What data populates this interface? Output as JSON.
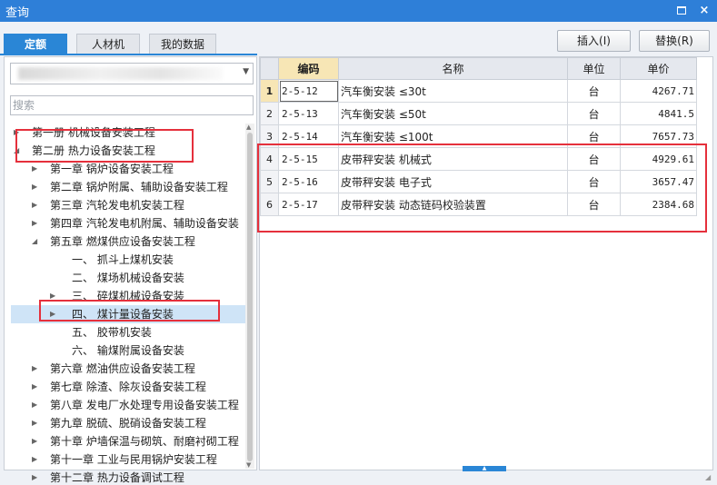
{
  "window": {
    "title": "查询",
    "maximize_icon": "maximize-icon",
    "close_symbol": "×"
  },
  "tabs": [
    {
      "label": "定额",
      "active": true
    },
    {
      "label": "人材机",
      "active": false
    },
    {
      "label": "我的数据",
      "active": false
    }
  ],
  "actions": {
    "insert_label": "插入(I)",
    "replace_label": "替换(R)"
  },
  "left": {
    "library_select": {
      "value": ""
    },
    "search": {
      "placeholder": "搜索"
    },
    "tree": [
      {
        "label": "第一册  机械设备安装工程",
        "level": 0,
        "state": "collapsed"
      },
      {
        "label": "第二册  热力设备安装工程",
        "level": 0,
        "state": "expanded"
      },
      {
        "label": "第一章  锅炉设备安装工程",
        "level": 1,
        "state": "collapsed"
      },
      {
        "label": "第二章  锅炉附属、辅助设备安装工程",
        "level": 1,
        "state": "collapsed"
      },
      {
        "label": "第三章  汽轮发电机安装工程",
        "level": 1,
        "state": "collapsed"
      },
      {
        "label": "第四章  汽轮发电机附属、辅助设备安装",
        "level": 1,
        "state": "collapsed"
      },
      {
        "label": "第五章  燃煤供应设备安装工程",
        "level": 1,
        "state": "expanded"
      },
      {
        "label": "一、  抓斗上煤机安装",
        "level": 2,
        "state": "leaf"
      },
      {
        "label": "二、  煤场机械设备安装",
        "level": 2,
        "state": "leaf"
      },
      {
        "label": "三、  碎煤机械设备安装",
        "level": 2,
        "state": "collapsed"
      },
      {
        "label": "四、  煤计量设备安装",
        "level": 2,
        "state": "collapsed",
        "selected": true
      },
      {
        "label": "五、  胶带机安装",
        "level": 2,
        "state": "leaf"
      },
      {
        "label": "六、  输煤附属设备安装",
        "level": 2,
        "state": "leaf"
      },
      {
        "label": "第六章  燃油供应设备安装工程",
        "level": 1,
        "state": "collapsed"
      },
      {
        "label": "第七章  除渣、除灰设备安装工程",
        "level": 1,
        "state": "collapsed"
      },
      {
        "label": "第八章  发电厂水处理专用设备安装工程",
        "level": 1,
        "state": "collapsed"
      },
      {
        "label": "第九章  脱硫、脱硝设备安装工程",
        "level": 1,
        "state": "collapsed"
      },
      {
        "label": "第十章  炉墙保温与砌筑、耐磨衬砌工程",
        "level": 1,
        "state": "collapsed"
      },
      {
        "label": "第十一章  工业与民用锅炉安装工程",
        "level": 1,
        "state": "collapsed"
      },
      {
        "label": "第十二章  热力设备调试工程",
        "level": 1,
        "state": "collapsed"
      }
    ]
  },
  "table": {
    "headers": {
      "code": "编码",
      "name": "名称",
      "unit": "单位",
      "price": "单价"
    },
    "rows": [
      {
        "no": "1",
        "code": "2-5-12",
        "name": "汽车衡安装  ≤30t",
        "unit": "台",
        "price": "4267.71"
      },
      {
        "no": "2",
        "code": "2-5-13",
        "name": "汽车衡安装  ≤50t",
        "unit": "台",
        "price": "4841.5"
      },
      {
        "no": "3",
        "code": "2-5-14",
        "name": "汽车衡安装  ≤100t",
        "unit": "台",
        "price": "7657.73"
      },
      {
        "no": "4",
        "code": "2-5-15",
        "name": "皮带秤安装  机械式",
        "unit": "台",
        "price": "4929.61"
      },
      {
        "no": "5",
        "code": "2-5-16",
        "name": "皮带秤安装  电子式",
        "unit": "台",
        "price": "3657.47"
      },
      {
        "no": "6",
        "code": "2-5-17",
        "name": "皮带秤安装  动态链码校验装置",
        "unit": "台",
        "price": "2384.68"
      }
    ]
  },
  "colors": {
    "titlebar": "#2e7fd8",
    "tab_active": "#2a86d6",
    "highlight": "#e5303c",
    "selected_row": "#cfe4f7"
  }
}
